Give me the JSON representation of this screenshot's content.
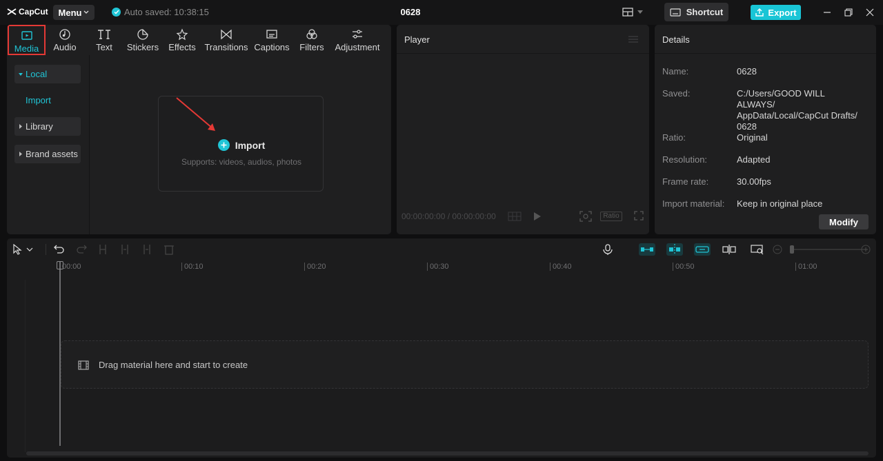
{
  "titlebar": {
    "brand": "CapCut",
    "menu_label": "Menu",
    "autosave": "Auto saved: 10:38:15",
    "project_name": "0628",
    "shortcut_label": "Shortcut",
    "export_label": "Export"
  },
  "media_tabs": [
    {
      "label": "Media",
      "icon": "media-icon",
      "active": true
    },
    {
      "label": "Audio",
      "icon": "audio-icon"
    },
    {
      "label": "Text",
      "icon": "text-icon"
    },
    {
      "label": "Stickers",
      "icon": "stickers-icon"
    },
    {
      "label": "Effects",
      "icon": "effects-icon"
    },
    {
      "label": "Transitions",
      "icon": "transitions-icon"
    },
    {
      "label": "Captions",
      "icon": "captions-icon"
    },
    {
      "label": "Filters",
      "icon": "filters-icon"
    },
    {
      "label": "Adjustment",
      "icon": "adjustment-icon"
    }
  ],
  "media_sidebar": {
    "local": "Local",
    "import": "Import",
    "library": "Library",
    "brand_assets": "Brand assets"
  },
  "import_box": {
    "label": "Import",
    "supports": "Supports: videos, audios, photos"
  },
  "player": {
    "title": "Player",
    "timecode": "00:00:00:00 / 00:00:00:00",
    "ratio_label": "Ratio"
  },
  "details": {
    "title": "Details",
    "rows": [
      {
        "key": "Name:",
        "value": "0628"
      },
      {
        "key": "Saved:",
        "value": "C:/Users/GOOD WILL ALWAYS/ AppData/Local/CapCut Drafts/ 0628"
      },
      {
        "key": "Ratio:",
        "value": "Original"
      },
      {
        "key": "Resolution:",
        "value": "Adapted"
      },
      {
        "key": "Frame rate:",
        "value": "30.00fps"
      },
      {
        "key": "Import material:",
        "value": "Keep in original place"
      }
    ],
    "modify_label": "Modify"
  },
  "timeline": {
    "ruler": [
      "00:00",
      "00:10",
      "00:20",
      "00:30",
      "00:40",
      "00:50",
      "01:00"
    ],
    "drop_hint": "Drag material here and start to create"
  },
  "colors": {
    "accent": "#20c5d6",
    "highlight_box": "#e53935",
    "arrow": "#e53935"
  }
}
